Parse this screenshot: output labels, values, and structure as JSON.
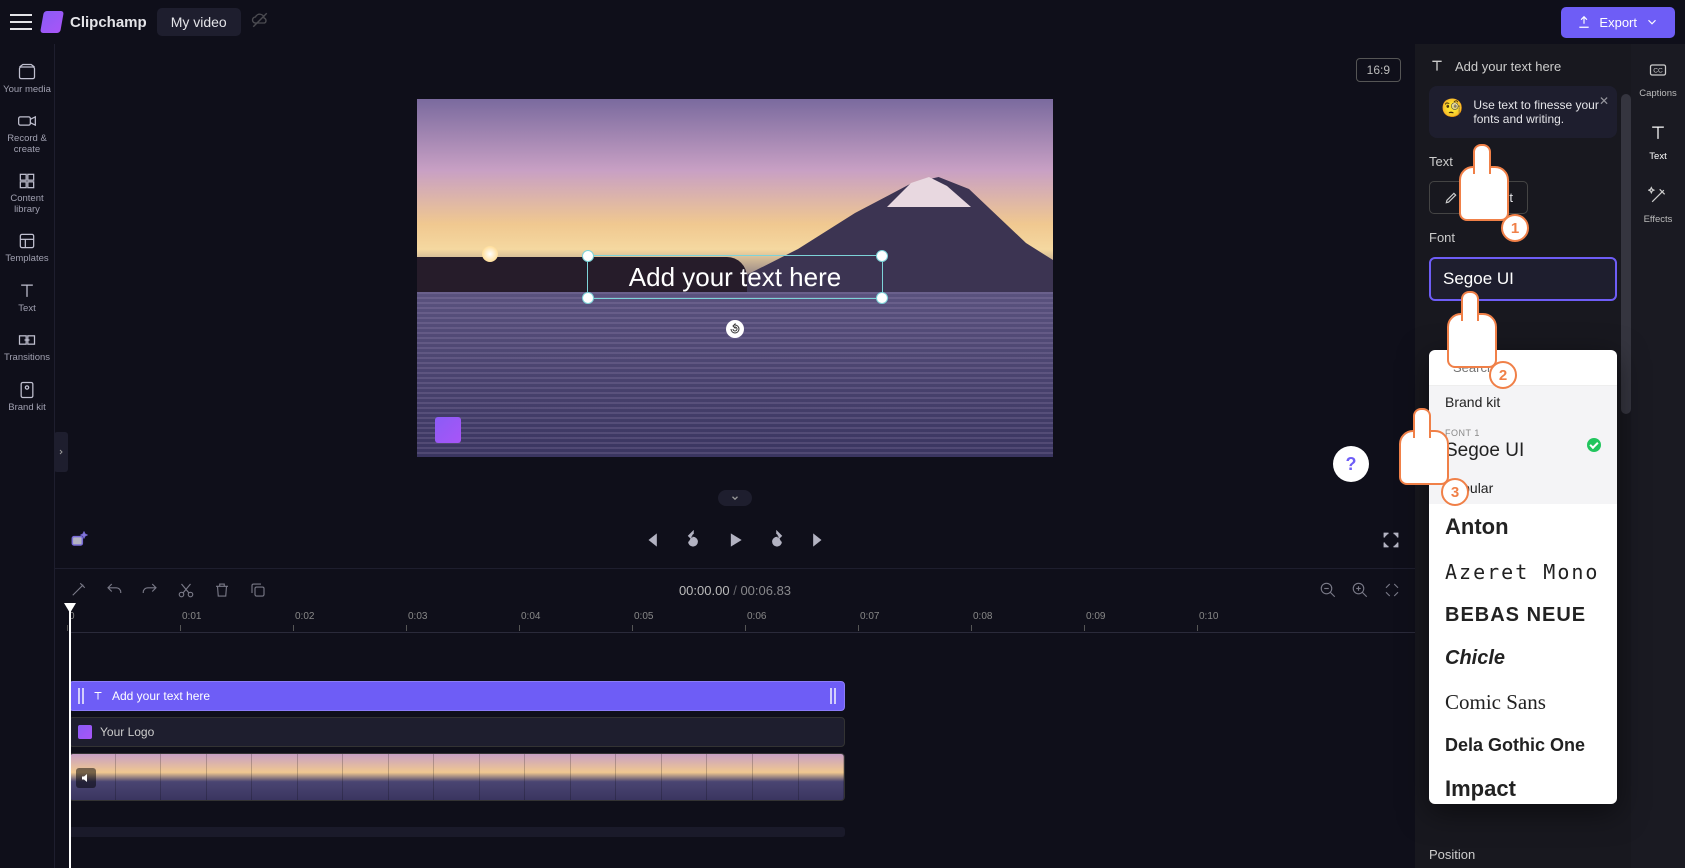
{
  "header": {
    "brand": "Clipchamp",
    "video_title": "My video",
    "export_label": "Export"
  },
  "left_rail": {
    "items": [
      {
        "label": "Your media"
      },
      {
        "label": "Record & create"
      },
      {
        "label": "Content library"
      },
      {
        "label": "Templates"
      },
      {
        "label": "Text"
      },
      {
        "label": "Transitions"
      },
      {
        "label": "Brand kit"
      }
    ]
  },
  "stage": {
    "aspect": "16:9",
    "text_overlay": "Add your text here"
  },
  "transport": {
    "current": "00:00.00",
    "duration": "00:06.83"
  },
  "timeline": {
    "ticks": [
      "0",
      "0:01",
      "0:02",
      "0:03",
      "0:04",
      "0:05",
      "0:06",
      "0:07",
      "0:08",
      "0:09",
      "0:10"
    ],
    "text_clip": "Add your text here",
    "logo_clip": "Your Logo"
  },
  "panel": {
    "header": "Add your text here",
    "tip": "Use text to finesse your fonts and writing.",
    "text_section": "Text",
    "edit_text": "Edit text",
    "font_section": "Font",
    "current_font": "Segoe UI",
    "position_section": "Position",
    "search_placeholder": "Search",
    "brandkit": "Brand kit",
    "font1_label": "FONT 1",
    "font1_name": "Segoe UI",
    "popular": "Popular",
    "fonts": [
      "Anton",
      "Azeret Mono",
      "BEBAS NEUE",
      "Chicle",
      "Comic Sans",
      "Dela Gothic One",
      "Impact"
    ]
  },
  "right_rail": {
    "items": [
      {
        "label": "Captions"
      },
      {
        "label": "Text"
      },
      {
        "label": "Effects"
      }
    ]
  },
  "pointers": {
    "p1": "1",
    "p2": "2",
    "p3": "3"
  }
}
